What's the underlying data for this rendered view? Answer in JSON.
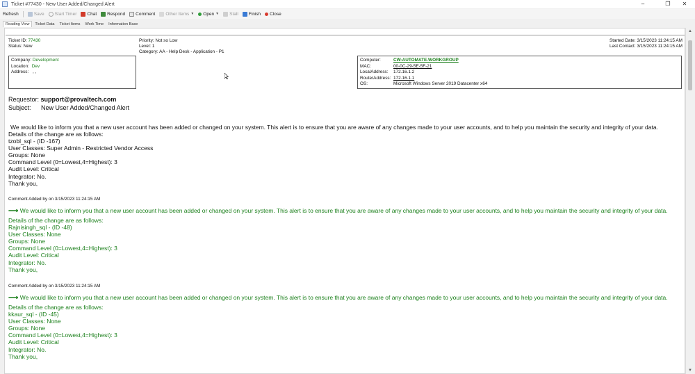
{
  "window": {
    "title": "Ticket #77430 - New User Added/Changed Alert",
    "controls": [
      "–",
      "❐",
      "✕"
    ]
  },
  "toolbar": {
    "refresh": "Refresh",
    "save": "Save",
    "start_timer": "Start Timer",
    "chat": "Chat",
    "respond": "Respond",
    "comment": "Comment",
    "other_items": "Other Items",
    "open": "Open",
    "stall": "Stall",
    "finish": "Finish",
    "close": "Close"
  },
  "tabs": [
    "Reading View",
    "Ticket Data",
    "Ticket Items",
    "Work Time",
    "Information Base"
  ],
  "ticket": {
    "id_label": "Ticket ID:",
    "id_value": "77430",
    "status_label": "Status:",
    "status_value": "New",
    "priority_label": "Priority:",
    "priority_value": "Not so Low",
    "level_label": "Level:",
    "level_value": "1",
    "category_label": "Category:",
    "category_value": "AA - Help Desk - Application - P1",
    "started_label": "Started Date:",
    "started_value": "3/15/2023 11:24:15 AM",
    "contact_label": "Last Contact:",
    "contact_value": "3/15/2023 11:24:15 AM"
  },
  "company": {
    "company_label": "Company:",
    "company_value": "Development",
    "location_label": "Location:",
    "location_value": "Dev",
    "address_label": "Address:",
    "address_value": ", ,"
  },
  "computer": {
    "computer_label": "Computer:",
    "computer_value": "CW-AUTOMATE.WORKGROUP",
    "mac_label": "MAC:",
    "mac_value": "00-0C-29-5E-5F-21",
    "local_label": "LocalAddress:",
    "local_value": "172.16.1.2",
    "router_label": "RouterAddress:",
    "router_value": "172.16.1.1",
    "os_label": "OS:",
    "os_value": "Microsoft Windows Server 2019 Datacenter x64"
  },
  "requestor": {
    "label": "Requestor:",
    "value": "support@provaltech.com",
    "subject_label": "Subject:",
    "subject_value": "New User Added/Changed Alert"
  },
  "message": {
    "intro": "We would like to inform you that a new user account has been added or changed on your system. This alert is to ensure that you are aware of any changes made to your user accounts, and to help you maintain the security and integrity of your data.",
    "lines": [
      "Details of the change are as follows:",
      "tzobl_sql - (ID -167)",
      "User Classes: Super Admin - Restricted Vendor Access",
      "Groups: None",
      "Command Level (0=Lowest,4=Highest): 3",
      "Audit Level: Critical",
      "Integrator: No.",
      "Thank you,"
    ]
  },
  "comments": [
    {
      "header": "Comment Added by on 3/15/2023 11:24:15 AM",
      "arrow": "⟶",
      "intro": "We would like to inform you that a new user account has been added or changed on your system. This alert is to ensure that you are aware of any changes made to your user accounts, and to help you maintain the security and integrity of your data.",
      "lines": [
        "Details of the change are as follows:",
        "Rajnisingh_sql - (ID -48)",
        "User Classes: None",
        "Groups: None",
        "Command Level (0=Lowest,4=Highest): 3",
        "Audit Level: Critical",
        "Integrator: No.",
        "Thank you,"
      ]
    },
    {
      "header": "Comment Added by on 3/15/2023 11:24:15 AM",
      "arrow": "⟶",
      "intro": "We would like to inform you that a new user account has been added or changed on your system. This alert is to ensure that you are aware of any changes made to your user accounts, and to help you maintain the security and integrity of your data.",
      "lines": [
        "Details of the change are as follows:",
        "kkaur_sql - (ID -45)",
        "User Classes: None",
        "Groups: None",
        "Command Level (0=Lowest,4=Highest): 3",
        "Audit Level: Critical",
        "Integrator: No.",
        "Thank you,"
      ]
    }
  ],
  "colors": {
    "accent_green": "#1a7f1a",
    "link_blue": "#1a56c7"
  }
}
